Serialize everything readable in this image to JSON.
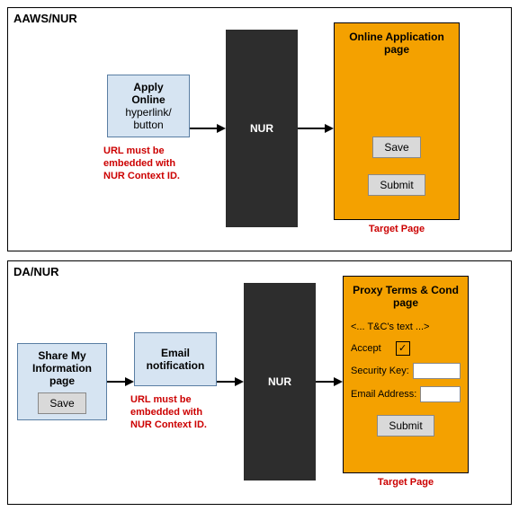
{
  "panel1": {
    "title": "AAWS/NUR",
    "apply": {
      "line1": "Apply",
      "line2": "Online",
      "line3": "hyperlink/",
      "line4": "button"
    },
    "note": "URL must be embedded with NUR Context ID.",
    "nur": "NUR",
    "target": {
      "title": "Online Application page",
      "save": "Save",
      "submit": "Submit",
      "label": "Target Page"
    }
  },
  "panel2": {
    "title": "DA/NUR",
    "share": {
      "title": "Share My Information page",
      "save": "Save"
    },
    "email": {
      "line1": "Email",
      "line2": "notification"
    },
    "note": "URL must be embedded with NUR Context ID.",
    "nur": "NUR",
    "target": {
      "title": "Proxy Terms & Cond page",
      "tc": "<... T&C's text ...>",
      "accept": "Accept",
      "check": "☑",
      "seckey": "Security Key:",
      "email": "Email Address:",
      "submit": "Submit",
      "label": "Target Page"
    }
  }
}
